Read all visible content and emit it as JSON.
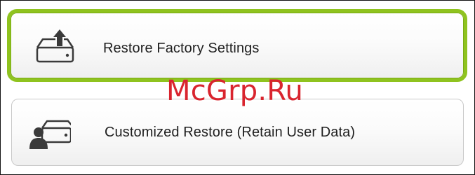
{
  "options": [
    {
      "label": "Restore Factory Settings",
      "icon": "drive-upload-icon",
      "selected": true
    },
    {
      "label": "Customized Restore (Retain User Data)",
      "icon": "user-drive-icon",
      "selected": false
    }
  ],
  "watermark": "McGrp.Ru",
  "colors": {
    "selected_border": "#8fc31f",
    "icon": "#3a3a3a",
    "label": "#1f1f1f",
    "watermark": "#d9242e"
  }
}
